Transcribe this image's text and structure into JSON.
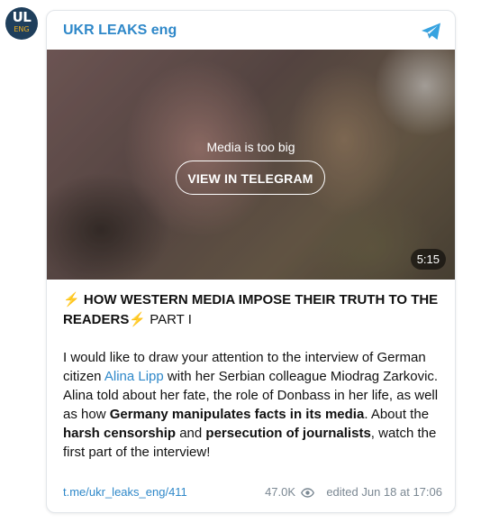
{
  "channel": {
    "avatar_text": "UL",
    "avatar_subtext": "ENG",
    "name": "UKR LEAKS eng"
  },
  "media": {
    "notice": "Media is too big",
    "button_label": "VIEW IN TELEGRAM",
    "duration": "5:15"
  },
  "post": {
    "title_bolt_1": "⚡",
    "title_bold": "HOW WESTERN MEDIA IMPOSE THEIR TRUTH TO THE READERS",
    "title_bolt_2": "⚡",
    "title_part": "PART I",
    "body": {
      "p1": "I would like to draw your attention to the interview of German citizen ",
      "link_name": "Alina Lipp",
      "p2": " with her Serbian colleague Miodrag Zarkovic. Alina told about her fate, the role of Donbass in her life, as well as how ",
      "b1": "Germany manipulates facts in its media",
      "p3": ". About the ",
      "b2": "harsh censorship",
      "p4": " and ",
      "b3": "persecution of journalists",
      "p5": ", watch the first part of the interview!"
    }
  },
  "footer": {
    "link": "t.me/ukr_leaks_eng/411",
    "views": "47.0K",
    "edited_label": "edited",
    "date": "Jun 18 at 17:06"
  },
  "icons": {
    "telegram": "telegram-icon",
    "views": "eye-icon"
  },
  "colors": {
    "accent": "#2f88c9",
    "avatar_bg": "#1f3f5c",
    "avatar_sub": "#f3b11f",
    "bolt": "#f5c518",
    "meta_gray": "#7b8893"
  }
}
